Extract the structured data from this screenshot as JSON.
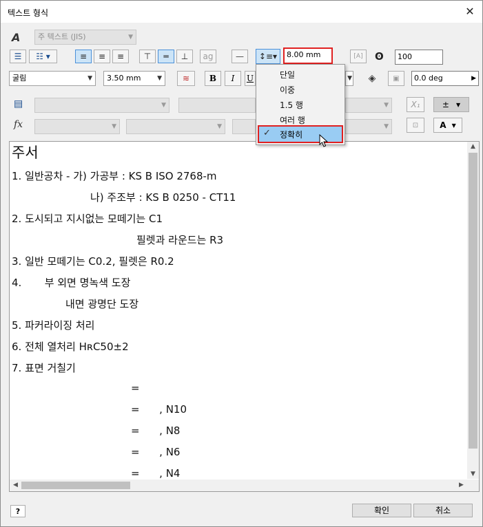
{
  "window": {
    "title": "텍스트 형식",
    "close_label": "✕"
  },
  "toolbar": {
    "style_combo": "주 텍스트 (JIS)",
    "line_spacing_value": "8.00 mm",
    "width_scale_value": "100",
    "font_combo": "굴림",
    "font_size_combo": "3.50 mm",
    "bold_label": "B",
    "italic_label": "I",
    "underline_label": "U",
    "rotation_value": "0.0 deg",
    "plus_minus_label": "±",
    "text_color_label": "A"
  },
  "line_spacing_menu": {
    "items": [
      "단일",
      "이중",
      "1.5 행",
      "여러 행",
      "정확히"
    ],
    "selected": "정확히"
  },
  "editor": {
    "lines": [
      "주서",
      "1. 일반공차 - 가) 가공부 : KS B ISO 2768-m",
      "나) 주조부 : KS B 0250 - CT11",
      "2. 도시되고 지시없는 모떼기는 C1",
      "필렛과 라운드는 R3",
      "3. 일반 모떼기는 C0.2, 필렛은 R0.2",
      "4.       부 외면 명녹색 도장",
      "내면 광명단 도장",
      "5. 파커라이징 처리",
      "6. 전체 열처리 HʀC50±2",
      "7. 표면 거칠기",
      "=",
      "=      , N10",
      "=      , N8",
      "=      , N6",
      "=      , N4"
    ]
  },
  "footer": {
    "ok_label": "확인",
    "cancel_label": "취소",
    "help_label": "?"
  },
  "colors": {
    "highlight_border": "#e02020",
    "menu_selection": "#99ccf3"
  }
}
